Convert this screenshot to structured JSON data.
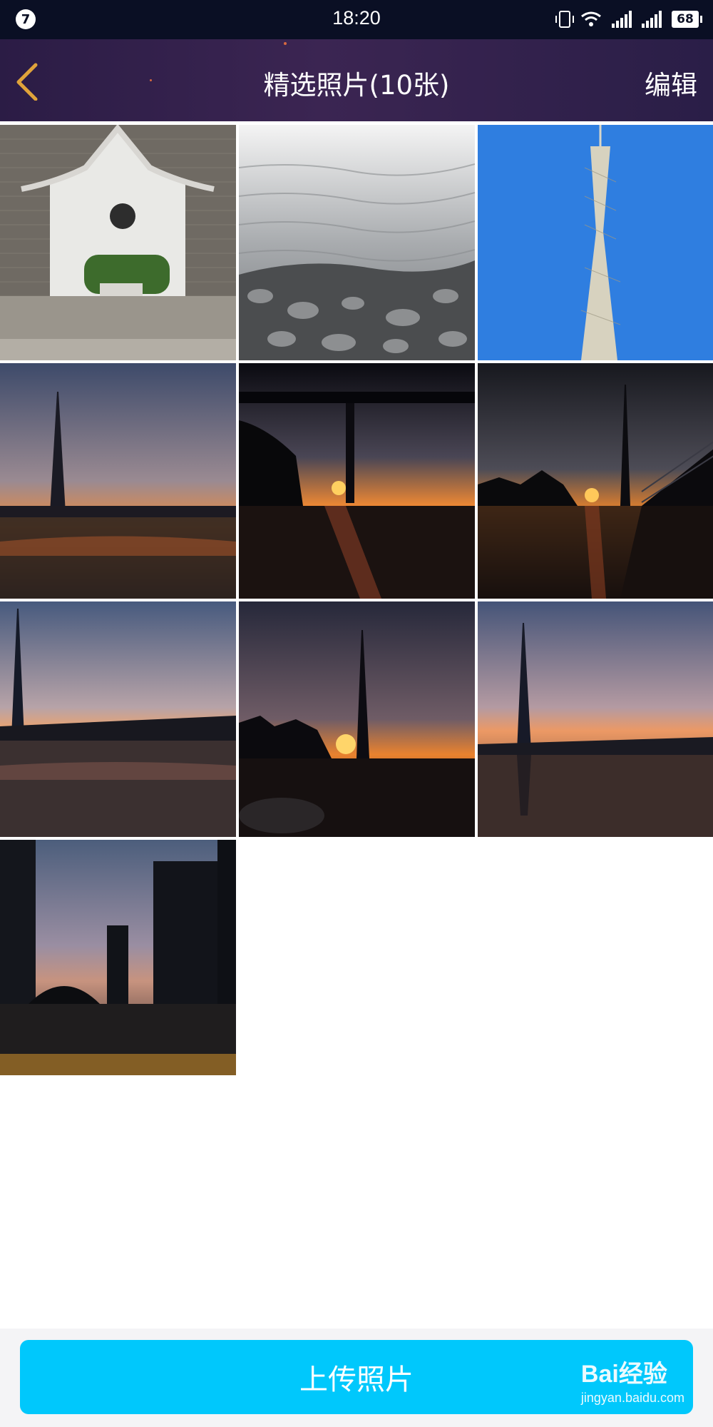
{
  "status_bar": {
    "notification_count": "7",
    "time": "18:20",
    "battery": "68",
    "icons": [
      "vibrate-icon",
      "wifi-icon",
      "signal-icon",
      "signal-2-icon",
      "battery-icon"
    ]
  },
  "header": {
    "back_icon": "chevron-left-icon",
    "title": "精选照片(10张)",
    "edit_label": "编辑"
  },
  "photos": [
    {
      "subject": "courtyard-gate"
    },
    {
      "subject": "water-rocks"
    },
    {
      "subject": "tower-blue-sky"
    },
    {
      "subject": "tower-sunset-river"
    },
    {
      "subject": "bridge-sunset"
    },
    {
      "subject": "tower-walkway-sunset"
    },
    {
      "subject": "tower-sunset-left"
    },
    {
      "subject": "tower-sun-behind"
    },
    {
      "subject": "tower-sunset-reflection"
    },
    {
      "subject": "city-buildings-dusk"
    }
  ],
  "footer": {
    "upload_label": "上传照片",
    "watermark_logo": "Bai经验",
    "watermark_url": "jingyan.baidu.com"
  },
  "colors": {
    "status_bar_bg": "#0a0f24",
    "header_bg": "#2b1c45",
    "accent_back": "#e0a33a",
    "upload_button": "#00c8fc"
  }
}
